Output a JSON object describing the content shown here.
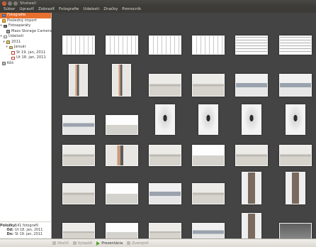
{
  "window": {
    "title": "Shotwell"
  },
  "menu": [
    "Súbor",
    "Upraviť",
    "Zobraziť",
    "Fotografie",
    "Udalosti",
    "Značky",
    "Pomocník"
  ],
  "sidebar": {
    "items": [
      {
        "label": "Fotografie",
        "icon": "photos-icon",
        "selected": true
      },
      {
        "label": "Posledný import",
        "icon": "import-icon"
      },
      {
        "label": "Fotoaparáty",
        "icon": "camera-icon",
        "expander": "▾"
      },
      {
        "label": "Mass Storage Camera",
        "icon": "storage-icon"
      },
      {
        "label": "Udalosti",
        "icon": "events-icon",
        "expander": "▾"
      },
      {
        "label": "2011",
        "icon": "folder-icon",
        "expander": "▾"
      },
      {
        "label": "Január",
        "icon": "folder-icon",
        "expander": "▾"
      },
      {
        "label": "St 19. jan, 2011",
        "icon": "day-icon"
      },
      {
        "label": "Ut 18. jan, 2011",
        "icon": "day-icon"
      },
      {
        "label": "Kôš",
        "icon": "trash-icon"
      }
    ]
  },
  "info": {
    "photos_label": "Položky:",
    "photos_value": "141 fotografií",
    "from_label": "Od:",
    "from_value": "Ut 18. jan, 2011",
    "to_label": "Do:",
    "to_value": "St 19. jan, 2011"
  },
  "toolbar": {
    "rotate": "Otočiť",
    "enhance": "Vylepšiť",
    "slideshow": "Prezentácia",
    "publish": "Zverejniť"
  }
}
